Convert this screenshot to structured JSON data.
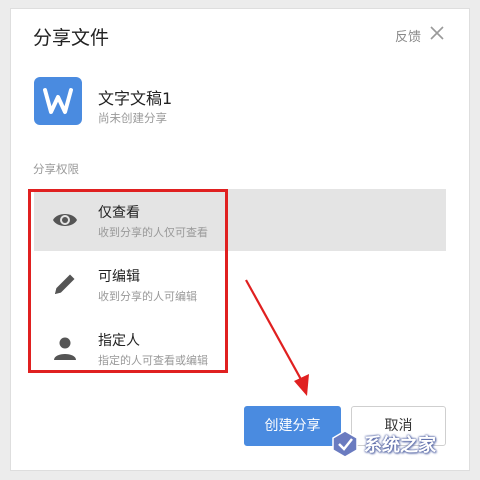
{
  "dialog": {
    "title": "分享文件",
    "feedback_label": "反馈"
  },
  "file": {
    "icon_letter": "W",
    "name": "文字文稿1",
    "status": "尚未创建分享"
  },
  "permissions": {
    "section_label": "分享权限",
    "options": [
      {
        "name": "仅查看",
        "desc": "收到分享的人仅可查看",
        "icon": "eye-icon",
        "selected": true
      },
      {
        "name": "可编辑",
        "desc": "收到分享的人可编辑",
        "icon": "pencil-icon",
        "selected": false
      },
      {
        "name": "指定人",
        "desc": "指定的人可查看或编辑",
        "icon": "person-icon",
        "selected": false
      }
    ]
  },
  "buttons": {
    "create": "创建分享",
    "cancel": "取消"
  },
  "watermark": {
    "text": "系统之家"
  },
  "colors": {
    "primary": "#4a8be0",
    "annotation": "#e02020",
    "selected_bg": "#e4e4e4"
  }
}
